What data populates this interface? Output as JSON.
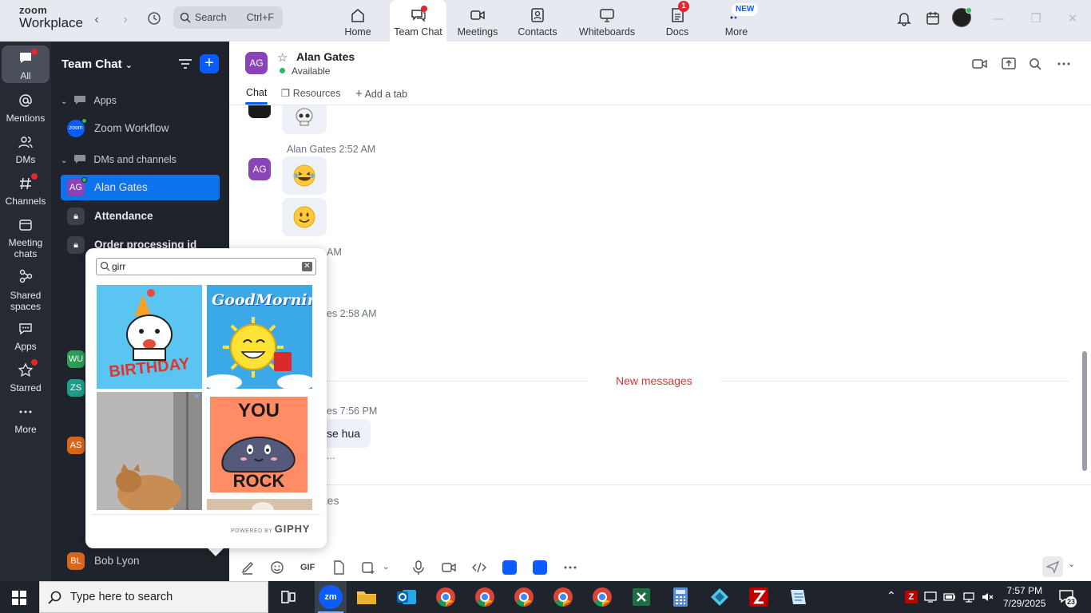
{
  "app": {
    "logo_line1": "zoom",
    "logo_line2": "Workplace",
    "search_label": "Search",
    "search_shortcut": "Ctrl+F"
  },
  "top_tabs": [
    {
      "label": "Home",
      "icon": "home-icon"
    },
    {
      "label": "Team Chat",
      "icon": "chat-icon",
      "active": true
    },
    {
      "label": "Meetings",
      "icon": "video-icon"
    },
    {
      "label": "Contacts",
      "icon": "contacts-icon"
    },
    {
      "label": "Whiteboards",
      "icon": "whiteboard-icon"
    },
    {
      "label": "Docs",
      "icon": "docs-icon",
      "badge": "1"
    },
    {
      "label": "More",
      "icon": "more-icon",
      "badge": "NEW"
    }
  ],
  "rail": [
    {
      "label": "All",
      "icon": "chat-bubble-icon"
    },
    {
      "label": "Mentions",
      "icon": "at-icon"
    },
    {
      "label": "DMs",
      "icon": "people-icon"
    },
    {
      "label": "Channels",
      "icon": "hash-icon"
    },
    {
      "label_1": "Meeting",
      "label_2": "chats",
      "icon": "calendar-icon"
    },
    {
      "label_1": "Shared",
      "label_2": "spaces",
      "icon": "shared-icon"
    },
    {
      "label": "Apps",
      "icon": "apps-icon"
    },
    {
      "label": "Starred",
      "icon": "star-icon"
    },
    {
      "label": "More",
      "icon": "ellipsis-icon"
    }
  ],
  "sidebar": {
    "title": "Team Chat",
    "sections": {
      "apps": "Apps",
      "dms": "DMs and channels"
    },
    "app_item": {
      "label": "Zoom Workflow",
      "avatar": "zoom"
    },
    "items": [
      {
        "name": "Alan Gates",
        "avatar": "AG",
        "selected": true
      },
      {
        "name": "Attendance",
        "avatar": "lock"
      },
      {
        "name": "Order processing id",
        "avatar": "lock"
      }
    ],
    "partial_avatars": [
      "WU",
      "ZS",
      "AS"
    ],
    "bottom_item": {
      "name": "Bob Lyon",
      "avatar": "BL"
    }
  },
  "chat": {
    "avatar": "AG",
    "name": "Alan Gates",
    "status": "Available",
    "tabs": [
      "Chat",
      "Resources",
      "Add a tab"
    ]
  },
  "messages": {
    "sender_1": "Alan Gates",
    "time_1": "2:52 AM",
    "avatar": "AG",
    "partial_time_2": "AM",
    "partial_line_3": "es 2:58 AM",
    "new_messages": "New messages",
    "partial_line_4": "es 7:56 PM",
    "partial_bubble": "se hua",
    "partial_ellipsis": "..."
  },
  "composer": {
    "placeholder_partial": "ates",
    "gif_label": "GIF"
  },
  "gif_popup": {
    "query": "girr",
    "powered_by": "POWERED BY",
    "brand": "GIPHY",
    "tile_1_text": "BIRTHDAY",
    "tile_2_text": "GoodMorning",
    "tile_4_line1": "YOU",
    "tile_4_line2": "ROCK"
  },
  "taskbar": {
    "search_placeholder": "Type here to search",
    "time": "7:57 PM",
    "date": "7/29/2025",
    "notification_count": "23"
  },
  "colors": {
    "accent": "#0b5cff",
    "rail_bg": "#262a33",
    "sidebar_bg": "#1f232b",
    "selected_row": "#0e72ed",
    "new_messages": "#d9383a",
    "avatar_ag": "#8b43b8"
  }
}
